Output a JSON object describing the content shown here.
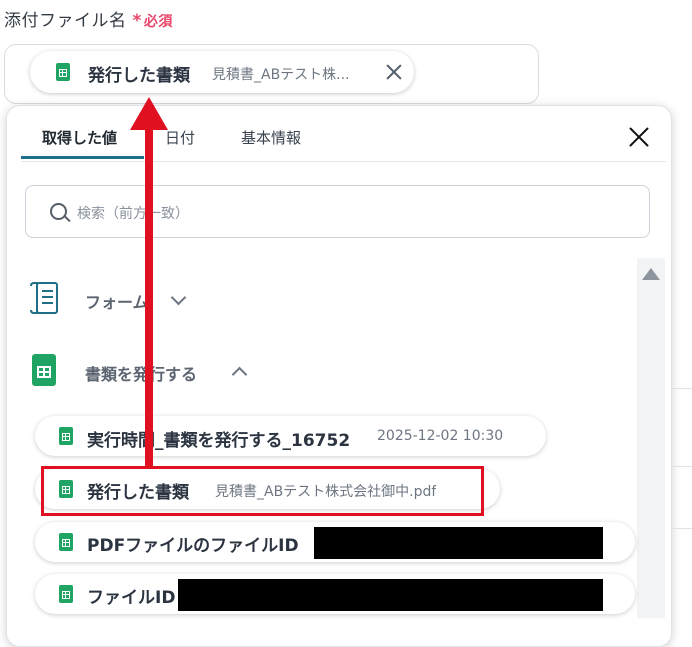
{
  "field": {
    "label": "添付ファイル名",
    "required_mark": "*",
    "required_text": "必須"
  },
  "selected_chip": {
    "label": "発行した書類",
    "value": "見積書_ABテスト株..."
  },
  "tabs": [
    {
      "label": "取得した値",
      "active": true
    },
    {
      "label": "日付",
      "active": false
    },
    {
      "label": "基本情報",
      "active": false
    }
  ],
  "search": {
    "placeholder": "検索（前方一致）"
  },
  "sections": {
    "form": {
      "label": "フォーム"
    },
    "issue": {
      "label": "書類を発行する"
    }
  },
  "outputs": [
    {
      "label": "実行時間_書類を発行する_16752",
      "value": "2025-12-02 10:30"
    },
    {
      "label": "発行した書類",
      "value": "見積書_ABテスト株式会社御中.pdf"
    },
    {
      "label": "PDFファイルのファイルID",
      "value": ""
    },
    {
      "label": "ファイルID",
      "value": ""
    }
  ],
  "colors": {
    "required": "#e8466a",
    "accent": "#1e6f8c",
    "sheets_green": "#1fa463",
    "annotation_red": "#e01020"
  },
  "icons": [
    "search-icon",
    "close-icon",
    "form-icon",
    "google-sheets-icon",
    "chevron-down-icon",
    "chevron-up-icon",
    "scroll-up-icon"
  ]
}
